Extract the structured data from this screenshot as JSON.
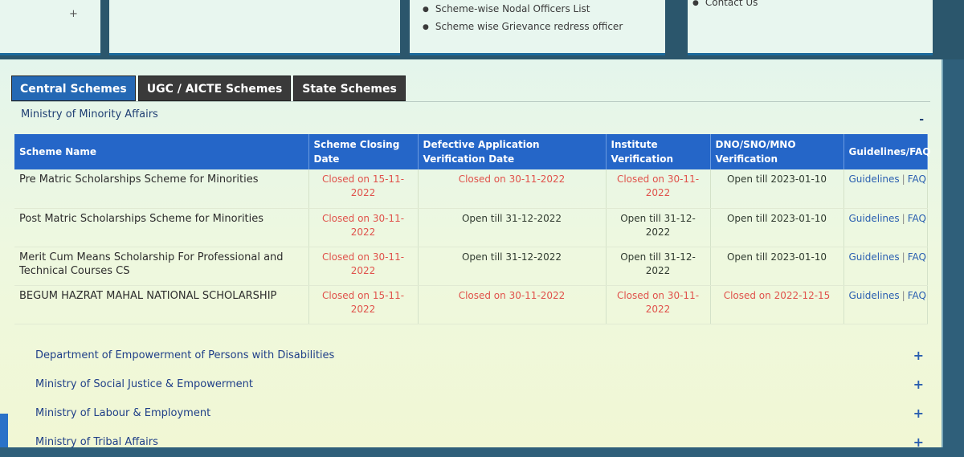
{
  "top_cards": {
    "card1_plus": "+",
    "card3_items": [
      "Scheme-wise Nodal Officers List",
      "Scheme wise Grievance redress officer"
    ],
    "card4_item": "Contact Us"
  },
  "tabs": [
    {
      "label": "Central Schemes",
      "active": true
    },
    {
      "label": "UGC / AICTE Schemes",
      "active": false
    },
    {
      "label": "State Schemes",
      "active": false
    }
  ],
  "section": {
    "title": "Ministry of Minority Affairs",
    "collapse_symbol": "-"
  },
  "table": {
    "headers": [
      "Scheme Name",
      "Scheme Closing Date",
      "Defective Application Verification Date",
      "Institute Verification",
      "DNO/SNO/MNO Verification",
      "Guidelines/FAQ"
    ],
    "rows": [
      {
        "name": "Pre Matric Scholarships Scheme for Minorities",
        "closing": "Closed on 15-11-2022",
        "defective": "Closed on 30-11-2022",
        "institute": "Closed on 30-11-2022",
        "dno": "Open till 2023-01-10",
        "guidelines": "Guidelines",
        "faq": "FAQ"
      },
      {
        "name": "Post Matric Scholarships Scheme for Minorities",
        "closing": "Closed on 30-11-2022",
        "defective": "Open till 31-12-2022",
        "institute": "Open till 31-12-2022",
        "dno": "Open till 2023-01-10",
        "guidelines": "Guidelines",
        "faq": "FAQ"
      },
      {
        "name": "Merit Cum Means Scholarship For Professional and Technical Courses CS",
        "closing": "Closed on 30-11-2022",
        "defective": "Open till 31-12-2022",
        "institute": "Open till 31-12-2022",
        "dno": "Open till 2023-01-10",
        "guidelines": "Guidelines",
        "faq": "FAQ"
      },
      {
        "name": "BEGUM HAZRAT MAHAL NATIONAL SCHOLARSHIP",
        "closing": "Closed on 15-11-2022",
        "defective": "Closed on 30-11-2022",
        "institute": "Closed on 30-11-2022",
        "dno": "Closed on 2022-12-15",
        "guidelines": "Guidelines",
        "faq": "FAQ"
      }
    ]
  },
  "departments": [
    {
      "label": "Department of Empowerment of Persons with Disabilities",
      "symbol": "+"
    },
    {
      "label": "Ministry of Social Justice & Empowerment",
      "symbol": "+"
    },
    {
      "label": "Ministry of Labour & Employment",
      "symbol": "+"
    },
    {
      "label": "Ministry of Tribal Affairs",
      "symbol": "+"
    }
  ],
  "colors": {
    "header_blue": "#2566c8",
    "closed_red": "#e0524b",
    "link_blue": "#2a5fb0"
  }
}
